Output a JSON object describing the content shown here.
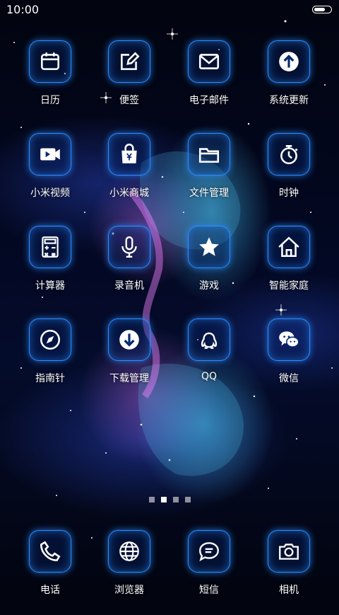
{
  "status_bar": {
    "time": "10:00",
    "battery_level": 0.7
  },
  "grid": [
    {
      "label": "日历",
      "icon": "calendar-icon"
    },
    {
      "label": "便签",
      "icon": "notes-icon"
    },
    {
      "label": "电子邮件",
      "icon": "mail-icon"
    },
    {
      "label": "系统更新",
      "icon": "update-icon"
    },
    {
      "label": "小米视频",
      "icon": "video-icon"
    },
    {
      "label": "小米商城",
      "icon": "shopping-bag-icon"
    },
    {
      "label": "文件管理",
      "icon": "folder-icon"
    },
    {
      "label": "时钟",
      "icon": "stopwatch-icon"
    },
    {
      "label": "计算器",
      "icon": "calculator-icon"
    },
    {
      "label": "录音机",
      "icon": "microphone-icon"
    },
    {
      "label": "游戏",
      "icon": "star-icon"
    },
    {
      "label": "智能家庭",
      "icon": "home-icon"
    },
    {
      "label": "指南针",
      "icon": "compass-icon"
    },
    {
      "label": "下载管理",
      "icon": "download-icon"
    },
    {
      "label": "QQ",
      "icon": "qq-icon"
    },
    {
      "label": "微信",
      "icon": "wechat-icon"
    }
  ],
  "page_indicator": {
    "count": 4,
    "active_index": 1
  },
  "dock": [
    {
      "label": "电话",
      "icon": "phone-icon"
    },
    {
      "label": "浏览器",
      "icon": "globe-icon"
    },
    {
      "label": "短信",
      "icon": "message-icon"
    },
    {
      "label": "相机",
      "icon": "camera-icon"
    }
  ],
  "colors": {
    "accent": "#2f8bff",
    "glow": "#46c8ff",
    "text": "#ffffff"
  }
}
